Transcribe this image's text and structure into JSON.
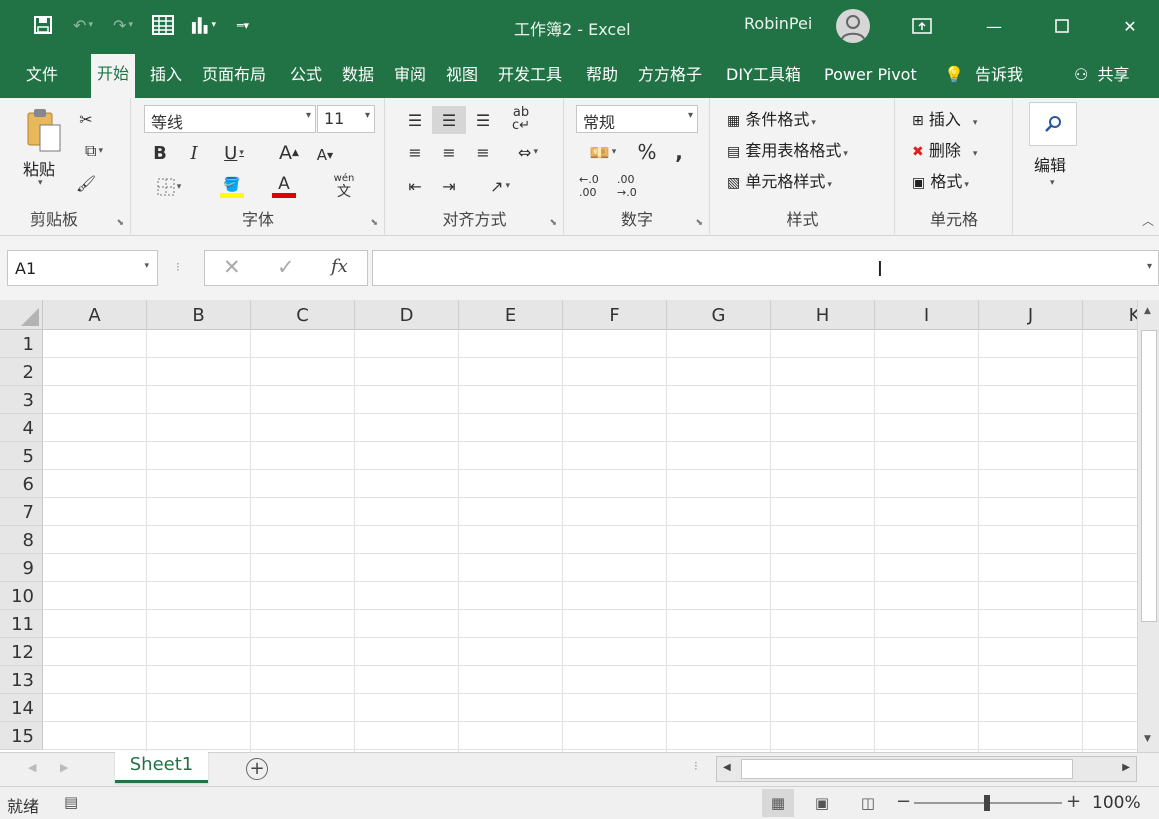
{
  "titlebar": {
    "document_title": "工作簿2  -  Excel",
    "user_name": "RobinPei",
    "qat": [
      "save-icon",
      "undo-icon",
      "redo-icon",
      "form-icon",
      "chart-icon",
      "customize-icon"
    ]
  },
  "tabs": [
    "文件",
    "开始",
    "插入",
    "页面布局",
    "公式",
    "数据",
    "审阅",
    "视图",
    "开发工具",
    "帮助",
    "方方格子",
    "DIY工具箱",
    "Power Pivot"
  ],
  "active_tab": "开始",
  "tell_me": "告诉我",
  "share": "共享",
  "ribbon": {
    "clipboard": {
      "label": "剪贴板",
      "paste": "粘贴"
    },
    "font": {
      "label": "字体",
      "font_name": "等线",
      "font_size": "11",
      "pinyin": "wén"
    },
    "alignment": {
      "label": "对齐方式",
      "wrap": "ab"
    },
    "number": {
      "label": "数字",
      "format": "常规",
      "percent": "%",
      "comma": ",",
      "inc_decimal": "←.0 .00",
      "dec_decimal": ".00 →.0"
    },
    "styles": {
      "label": "样式",
      "conditional": "条件格式",
      "table": "套用表格格式",
      "cell_styles": "单元格样式"
    },
    "cells": {
      "label": "单元格",
      "insert": "插入",
      "delete": "删除",
      "format": "格式"
    },
    "editing": {
      "label": "编辑"
    }
  },
  "formula_bar": {
    "name_box": "A1",
    "fx": "fx",
    "value": ""
  },
  "columns": [
    "A",
    "B",
    "C",
    "D",
    "E",
    "F",
    "G",
    "H",
    "I",
    "J",
    "K"
  ],
  "rows": [
    "1",
    "2",
    "3",
    "4",
    "5",
    "6",
    "7",
    "8",
    "9",
    "10",
    "11",
    "12",
    "13",
    "14",
    "15"
  ],
  "sheets": [
    "Sheet1"
  ],
  "statusbar": {
    "ready": "就绪",
    "zoom": "100%"
  },
  "colors": {
    "brand": "#217346",
    "ribbon_bg": "#f3f3f3",
    "font_color": "#e00000",
    "highlight": "#ffff00"
  }
}
